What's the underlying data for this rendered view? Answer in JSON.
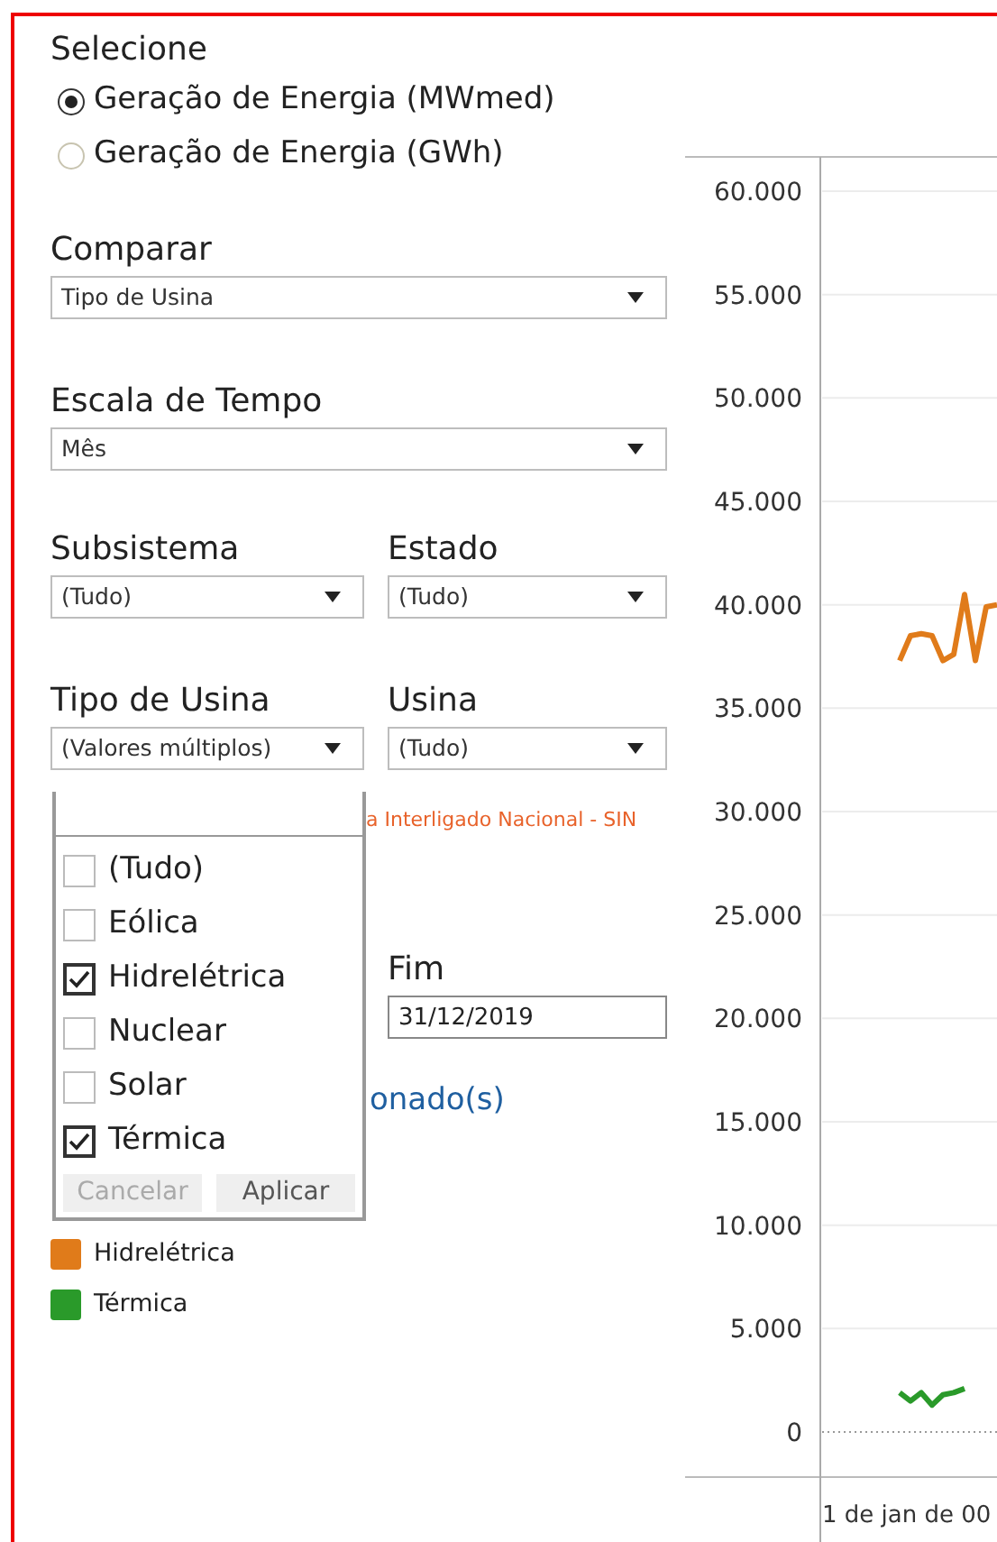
{
  "selector": {
    "title": "Selecione",
    "options": [
      {
        "label": "Geração de Energia (MWmed)",
        "selected": true
      },
      {
        "label": "Geração de Energia (GWh)",
        "selected": false
      }
    ]
  },
  "filters": [
    {
      "label": "Comparar",
      "value": "Tipo de Usina"
    },
    {
      "label": "Escala de Tempo",
      "value": "Mês"
    }
  ],
  "filter_pairs": [
    [
      {
        "label": "Subsistema",
        "value": "(Tudo)"
      },
      {
        "label": "Estado",
        "value": "(Tudo)"
      }
    ],
    [
      {
        "label": "Tipo de Usina",
        "value": "(Valores múltiplos)"
      },
      {
        "label": "Usina",
        "value": "(Tudo)"
      }
    ]
  ],
  "note": "a Interligado Nacional - SIN",
  "end_date": {
    "label": "Fim",
    "value": "31/12/2019"
  },
  "selected_link": "onado(s)",
  "dropdown_popup": {
    "items": [
      {
        "label": "(Tudo)",
        "checked": false
      },
      {
        "label": "Eólica",
        "checked": false
      },
      {
        "label": "Hidrelétrica",
        "checked": true
      },
      {
        "label": "Nuclear",
        "checked": false
      },
      {
        "label": "Solar",
        "checked": false
      },
      {
        "label": "Térmica",
        "checked": true
      }
    ],
    "buttons": [
      {
        "label": "Cancelar",
        "disabled": true
      },
      {
        "label": "Aplicar",
        "disabled": false
      }
    ]
  },
  "x_axis_first_label": "1 de jan de 00",
  "chart_data": {
    "type": "line",
    "grid": true,
    "ylim": [
      0,
      60000
    ],
    "yticks": [
      {
        "value": 0,
        "label": "0"
      },
      {
        "value": 5000,
        "label": "5.000"
      },
      {
        "value": 10000,
        "label": "10.000"
      },
      {
        "value": 15000,
        "label": "15.000"
      },
      {
        "value": 20000,
        "label": "20.000"
      },
      {
        "value": 25000,
        "label": "25.000"
      },
      {
        "value": 30000,
        "label": "30.000"
      },
      {
        "value": 35000,
        "label": "35.000"
      },
      {
        "value": 40000,
        "label": "40.000"
      },
      {
        "value": 45000,
        "label": "45.000"
      },
      {
        "value": 50000,
        "label": "50.000"
      },
      {
        "value": 55000,
        "label": "55.000"
      },
      {
        "value": 60000,
        "label": "60.000"
      }
    ],
    "series": [
      {
        "name": "Hidrelétrica",
        "color": "#e07b1a",
        "values": [
          37300,
          38500,
          38600,
          38500,
          37300,
          37600,
          40500,
          37300,
          39900,
          40000
        ]
      },
      {
        "name": "Térmica",
        "color": "#2a9a2a",
        "values": [
          1900,
          1500,
          1900,
          1300,
          1800,
          1900,
          2100,
          null,
          null,
          null
        ]
      }
    ]
  }
}
